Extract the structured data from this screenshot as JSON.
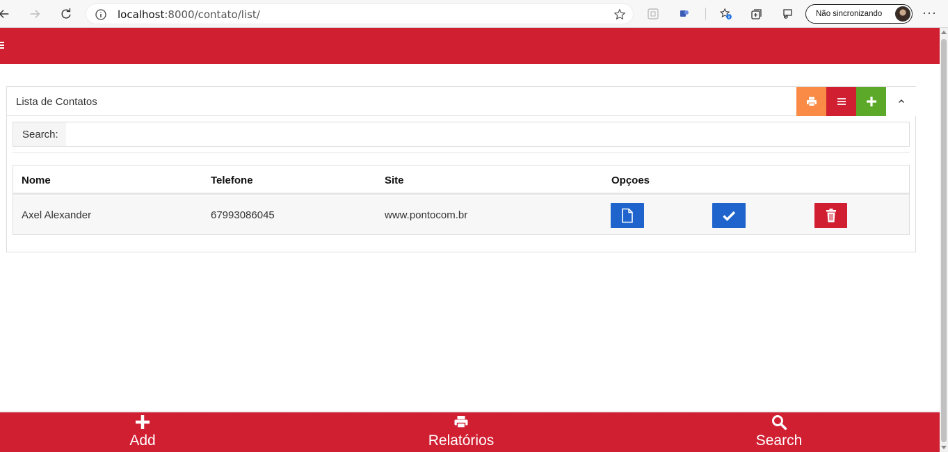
{
  "browser": {
    "url_host": "localhost",
    "url_rest": ":8000/contato/list/",
    "sync_label": "Não sincronizando"
  },
  "panel": {
    "title": "Lista de Contatos",
    "search_label": "Search:",
    "search_value": ""
  },
  "table": {
    "headers": [
      "Nome",
      "Telefone",
      "Site",
      "Opçoes"
    ],
    "rows": [
      {
        "nome": "Axel Alexander",
        "telefone": "67993086045",
        "site": "www.pontocom.br"
      }
    ]
  },
  "bottom_nav": {
    "add": "Add",
    "reports": "Relatórios",
    "search": "Search"
  },
  "colors": {
    "brand_red": "#d11f32",
    "print_orange": "#f98b47",
    "add_green": "#5ca92a",
    "action_blue": "#1e64cc"
  }
}
